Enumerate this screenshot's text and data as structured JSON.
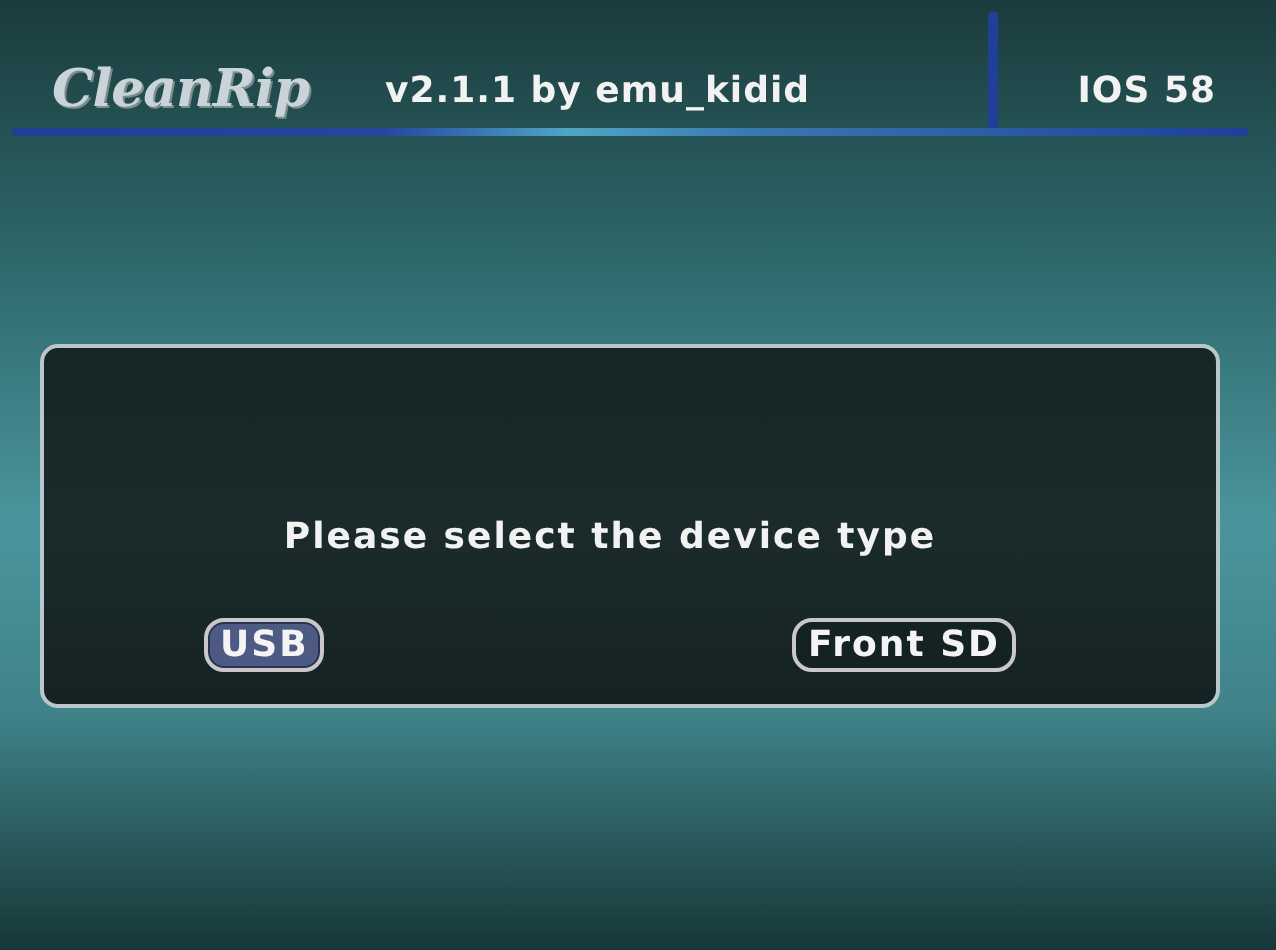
{
  "header": {
    "logo": "CleanRip",
    "version": "v2.1.1 by emu_kidid",
    "ios": "IOS 58"
  },
  "dialog": {
    "message": "Please select the device type",
    "options": [
      {
        "label": "USB",
        "selected": true
      },
      {
        "label": "Front SD",
        "selected": false
      }
    ]
  }
}
